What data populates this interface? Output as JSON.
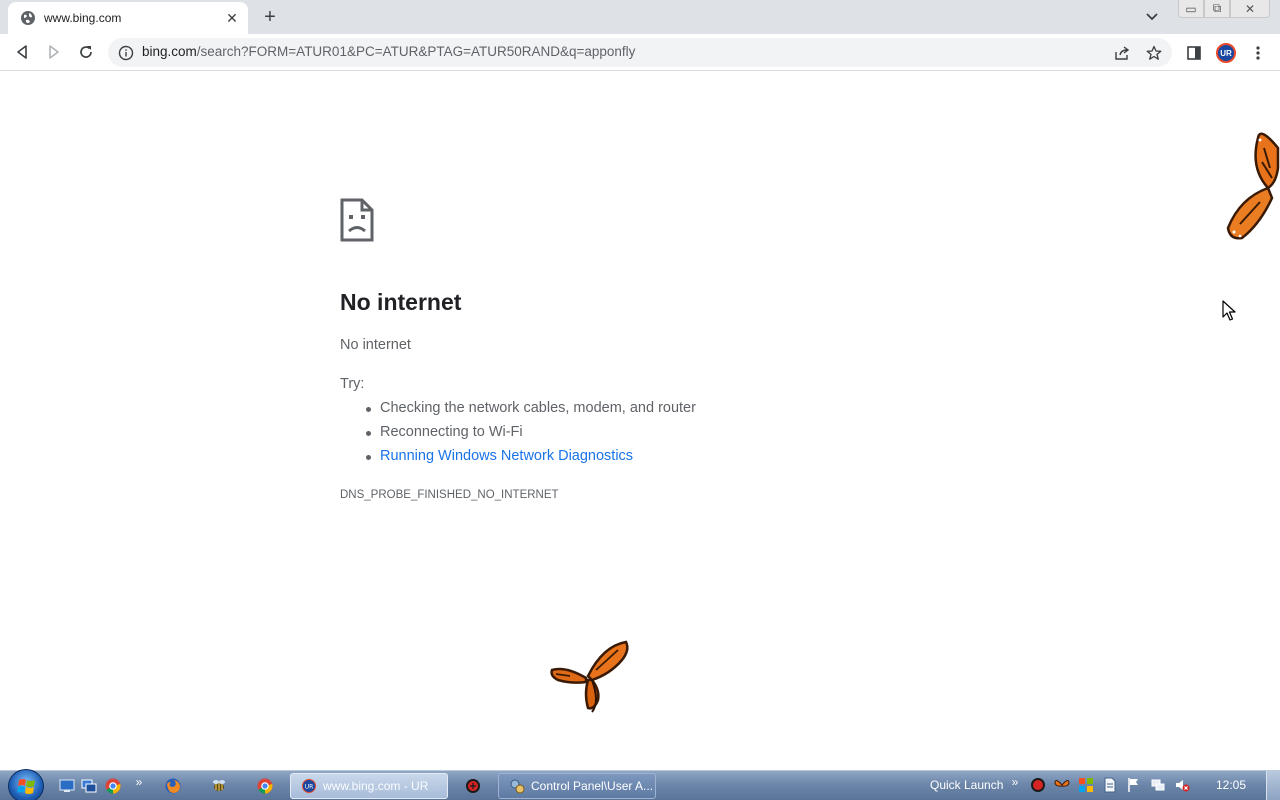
{
  "browser": {
    "tab": {
      "title": "www.bing.com",
      "favicon": "globe-icon",
      "close_glyph": "✕"
    },
    "new_tab_glyph": "+",
    "url": {
      "host": "bing.com",
      "path": "/search?FORM=ATUR01&PC=ATUR&PTAG=ATUR50RAND&q=apponfly"
    },
    "profile_initials": "UR",
    "window_controls": [
      "▭",
      "⧉",
      "✕"
    ]
  },
  "error_page": {
    "title": "No internet",
    "subtitle": "No internet",
    "try_label": "Try:",
    "suggestions": [
      "Checking the network cables, modem, and router",
      "Reconnecting to Wi-Fi",
      "Running Windows Network Diagnostics"
    ],
    "error_code": "DNS_PROBE_FINISHED_NO_INTERNET"
  },
  "taskbar": {
    "overflow_glyph": "»",
    "tasks": [
      {
        "label": "www.bing.com - UR",
        "icon": "ur-browser-icon",
        "active": true
      },
      {
        "label": "Control Panel\\User A...",
        "icon": "control-panel-icon",
        "active": false
      }
    ],
    "quick_launch_label": "Quick Launch",
    "clock": "12:05"
  },
  "colors": {
    "link": "#1a73e8",
    "text_secondary": "#5f6368",
    "tabstrip": "#dee1e6",
    "butterfly": "#e8731a"
  }
}
